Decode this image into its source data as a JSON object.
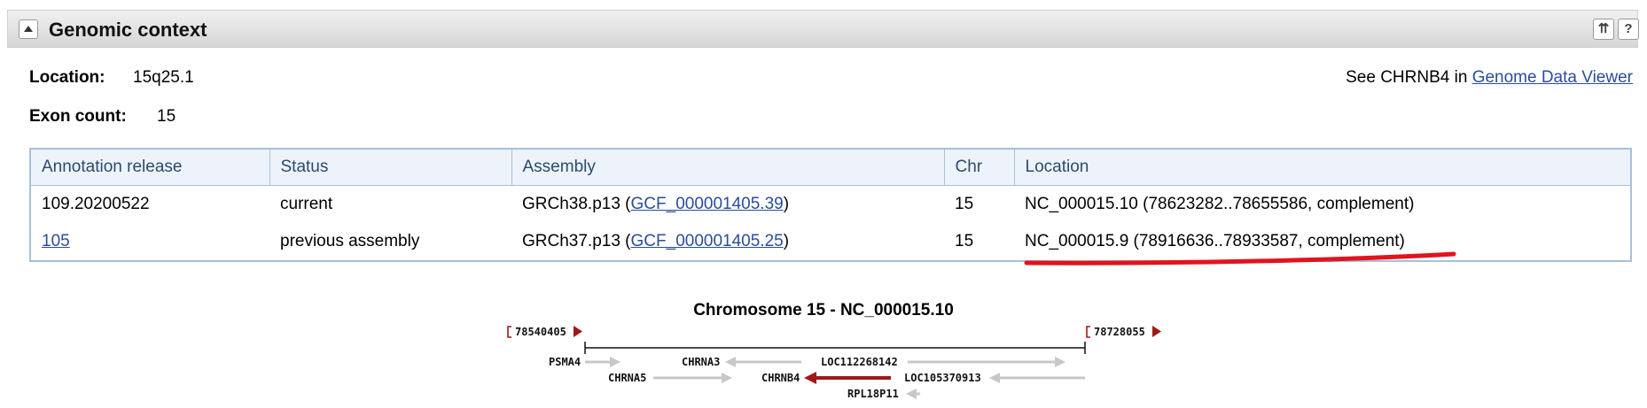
{
  "header": {
    "title": "Genomic context",
    "icon_top": "⇈",
    "icon_help": "?"
  },
  "location": {
    "label": "Location:",
    "value": "15q25.1"
  },
  "exon_count": {
    "label": "Exon count:",
    "value": "15"
  },
  "gdv": {
    "prefix": "See CHRNB4 in ",
    "link": "Genome Data Viewer"
  },
  "table": {
    "headers": [
      "Annotation release",
      "Status",
      "Assembly",
      "Chr",
      "Location"
    ],
    "rows": [
      {
        "release": "109.20200522",
        "status": "current",
        "assembly_name": "GRCh38.p13",
        "assembly_acc": "GCF_000001405.39",
        "chr": "15",
        "location": "NC_000015.10 (78623282..78655586, complement)"
      },
      {
        "release": "105",
        "status": "previous assembly",
        "assembly_name": "GRCh37.p13",
        "assembly_acc": "GCF_000001405.25",
        "chr": "15",
        "location": "NC_000015.9 (78916636..78933587, complement)"
      }
    ]
  },
  "graph": {
    "title": "Chromosome 15 - NC_000015.10",
    "start": "78540405",
    "end": "78728055",
    "genes": [
      {
        "name": "PSMA4",
        "row": 1,
        "direction": "right",
        "highlight": false
      },
      {
        "name": "CHRNA3",
        "row": 1,
        "direction": "left",
        "highlight": false
      },
      {
        "name": "LOC112268142",
        "row": 1,
        "direction": "right",
        "highlight": false
      },
      {
        "name": "CHRNA5",
        "row": 2,
        "direction": "right",
        "highlight": false
      },
      {
        "name": "CHRNB4",
        "row": 2,
        "direction": "left",
        "highlight": true
      },
      {
        "name": "LOC105370913",
        "row": 2,
        "direction": "left",
        "highlight": false
      },
      {
        "name": "RPL18P11",
        "row": 3,
        "direction": "left",
        "highlight": false
      }
    ]
  },
  "colors": {
    "highlight_gene": "#a01818",
    "gene": "#c8c8c8",
    "annotation_red": "#e0141e",
    "link": "#2a4d9a"
  }
}
